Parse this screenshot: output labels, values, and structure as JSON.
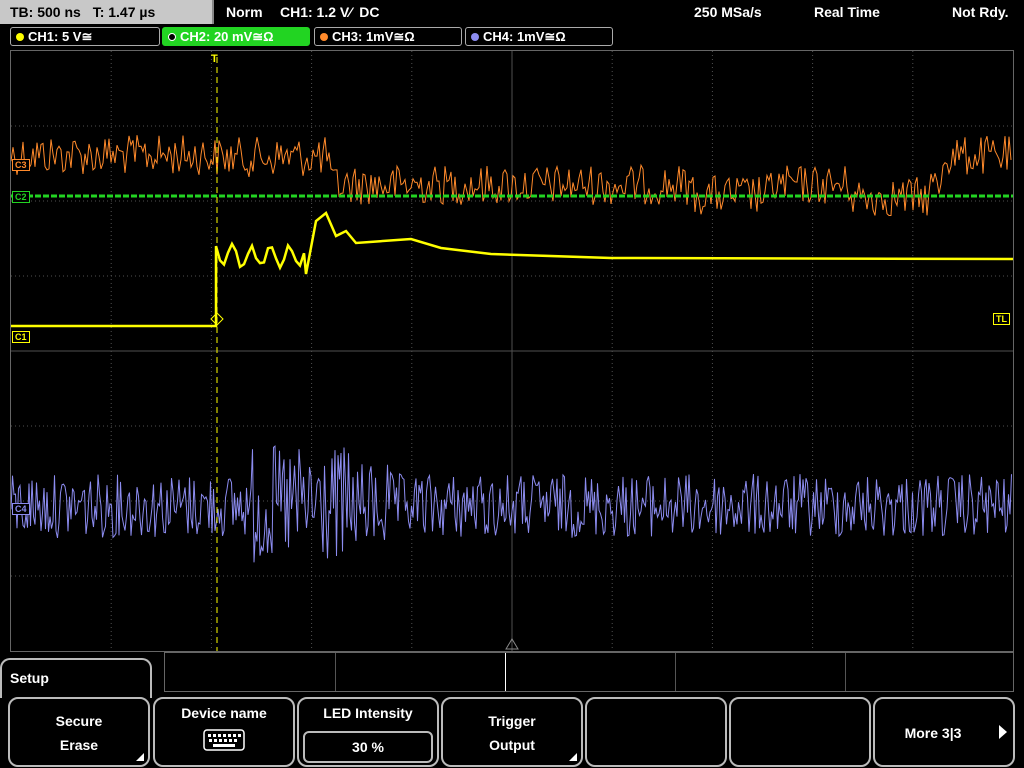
{
  "status_bar": {
    "timebase": "TB: 500 ns",
    "trigger_time": "T: 1.47 µs",
    "trigger_mode": "Norm",
    "trigger_source": "CH1: 1.2 V",
    "trigger_slope_coupling": "DC",
    "sample_rate": "250 MSa/s",
    "acquisition_mode": "Real Time",
    "state": "Not Rdy."
  },
  "channels": [
    {
      "label": "CH1: 5 V≅",
      "color": "#ffff00",
      "active": false
    },
    {
      "label": "CH2: 20 mV≅Ω",
      "color": "#22d422",
      "active": true
    },
    {
      "label": "CH3: 1mV≅Ω",
      "color": "#ff8a2b",
      "active": false
    },
    {
      "label": "CH4: 1mV≅Ω",
      "color": "#8c8cf0",
      "active": false
    }
  ],
  "screen": {
    "trigger_level_marker": "TL",
    "ch1_marker": "C1",
    "ch2_marker": "C2",
    "ch3_marker": "C3",
    "ch4_marker": "C4",
    "trigger_pos_marker": "T"
  },
  "menu": {
    "title": "Setup",
    "softkeys": {
      "secure_erase_l1": "Secure",
      "secure_erase_l2": "Erase",
      "device_name": "Device name",
      "led_intensity": "LED Intensity",
      "led_value": "30 %",
      "trigger_output_l1": "Trigger",
      "trigger_output_l2": "Output",
      "more": "More 3|3"
    }
  },
  "colors": {
    "ch1": "#ffff00",
    "ch2": "#22d422",
    "ch3": "#ff8a2b",
    "ch4": "#8c8cf0",
    "grid": "#505050"
  },
  "icons": [
    "keyboard-icon",
    "arrow-right-icon",
    "submenu-triangle-icon"
  ]
}
